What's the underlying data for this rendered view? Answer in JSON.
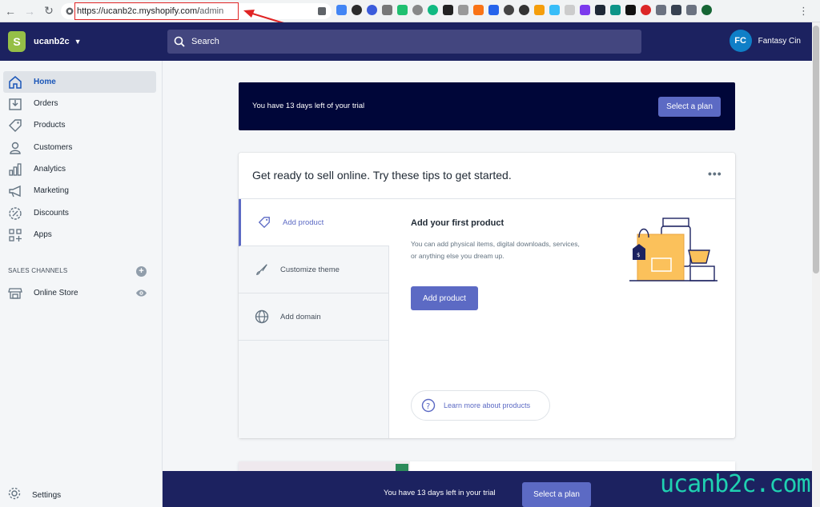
{
  "browser": {
    "url_host": "https://ucanb2c.myshopify.com/",
    "url_path": "admin"
  },
  "topbar": {
    "store_name": "ucanb2c",
    "search_placeholder": "Search",
    "user_initials": "FC",
    "user_name": "Fantasy Cin"
  },
  "sidebar": {
    "items": [
      {
        "label": "Home",
        "icon": "home-icon"
      },
      {
        "label": "Orders",
        "icon": "orders-icon"
      },
      {
        "label": "Products",
        "icon": "tag-icon"
      },
      {
        "label": "Customers",
        "icon": "person-icon"
      },
      {
        "label": "Analytics",
        "icon": "bar-chart-icon"
      },
      {
        "label": "Marketing",
        "icon": "megaphone-icon"
      },
      {
        "label": "Discounts",
        "icon": "discount-icon"
      },
      {
        "label": "Apps",
        "icon": "apps-icon"
      }
    ],
    "sales_channels_heading": "SALES CHANNELS",
    "online_store": "Online Store",
    "settings": "Settings"
  },
  "trial": {
    "text": "You have 13 days left of your trial",
    "button": "Select a plan"
  },
  "tips": {
    "title": "Get ready to sell online. Try these tips to get started.",
    "more": "•••",
    "tabs": [
      {
        "label": "Add product"
      },
      {
        "label": "Customize theme"
      },
      {
        "label": "Add domain"
      }
    ],
    "active_title": "Add your first product",
    "active_desc": "You can add physical items, digital downloads, services, or anything else you dream up.",
    "primary_button": "Add product",
    "learn_more": "Learn more about products"
  },
  "bottom_bar": {
    "text": "You have 13 days left in your trial",
    "button": "Select a plan"
  },
  "watermark": "ucanb2c.com",
  "colors": {
    "topbar": "#1c2260",
    "accent": "#5c6ac4",
    "trial_bg": "#000639",
    "active_nav": "#1a56b8"
  }
}
